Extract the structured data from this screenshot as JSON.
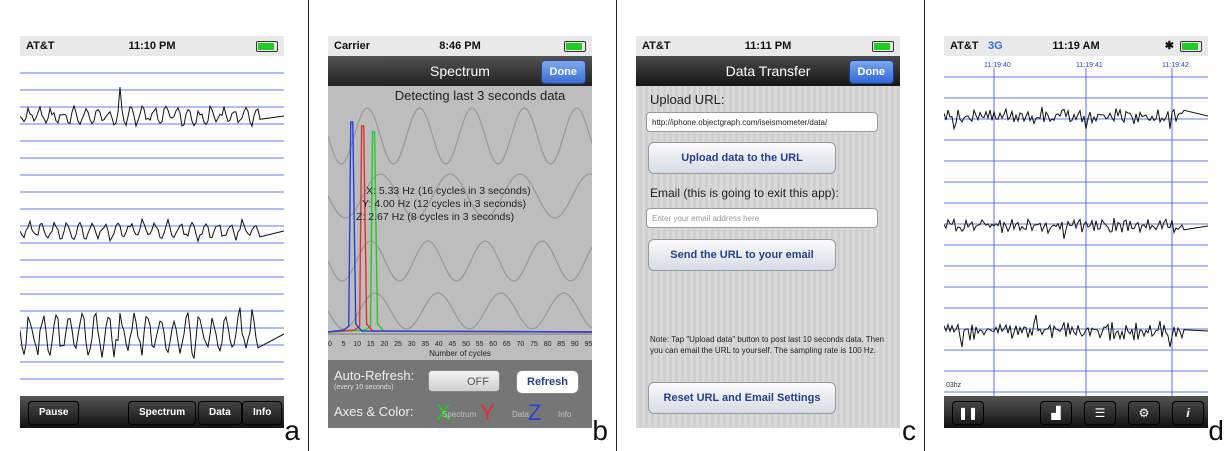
{
  "panels": {
    "a": {
      "letter": "a",
      "status": {
        "carrier": "AT&T",
        "time": "11:10 PM"
      },
      "toolbar": {
        "pause": "Pause",
        "spectrum": "Spectrum",
        "data": "Data",
        "info": "Info"
      }
    },
    "b": {
      "letter": "b",
      "status": {
        "carrier": "Carrier",
        "time": "8:46 PM"
      },
      "nav": {
        "title": "Spectrum",
        "done": "Done"
      },
      "detecting": "Detecting last 3 seconds data",
      "readouts": {
        "x": "X: 5.33 Hz (16 cycles in 3 seconds)",
        "y": "Y: 4.00 Hz (12 cycles in 3 seconds)",
        "z": "Z: 2.67 Hz (8 cycles in 3 seconds)"
      },
      "axis_ticks": [
        "0",
        "5",
        "10",
        "15",
        "20",
        "25",
        "30",
        "35",
        "40",
        "45",
        "50",
        "55",
        "60",
        "65",
        "70",
        "75",
        "80",
        "85",
        "90",
        "95"
      ],
      "axis_label": "Number of cycles",
      "auto_refresh": {
        "label": "Auto-Refresh:",
        "sublabel": "(every 10 seconds)",
        "toggle": "OFF",
        "button": "Refresh"
      },
      "axes_color": {
        "label": "Axes & Color:",
        "x": "X",
        "y": "Y",
        "z": "Z",
        "x_small": "Spectrum",
        "z_small": "Data",
        "info": "Info"
      }
    },
    "c": {
      "letter": "c",
      "status": {
        "carrier": "AT&T",
        "time": "11:11 PM"
      },
      "nav": {
        "title": "Data Transfer",
        "done": "Done"
      },
      "upload_label": "Upload URL:",
      "upload_url": "http://iphone.objectgraph.com/iseismometer/data/",
      "upload_button": "Upload data to the URL",
      "email_label": "Email (this is going to exit this app):",
      "email_placeholder": "Enter your email address here",
      "send_button": "Send the URL to your email",
      "note": "Note: Tap \"Upload data\" button to post last 10 seconds data. Then you can email the URL to yourself. The sampling rate is 100 Hz.",
      "reset_button": "Reset URL and Email Settings"
    },
    "d": {
      "letter": "d",
      "status": {
        "carrier": "AT&T",
        "network": "3G",
        "time": "11:19 AM"
      },
      "time_marks": [
        "11:19:40",
        "11:19:41",
        "11:19:42"
      ],
      "rate": "03hz"
    }
  },
  "colors": {
    "trace": "#111111",
    "grid": "#3a4bd6",
    "x": "#22cc22",
    "y": "#e23030",
    "z": "#2a3fe0",
    "nav_blue": "#2f68d6"
  }
}
